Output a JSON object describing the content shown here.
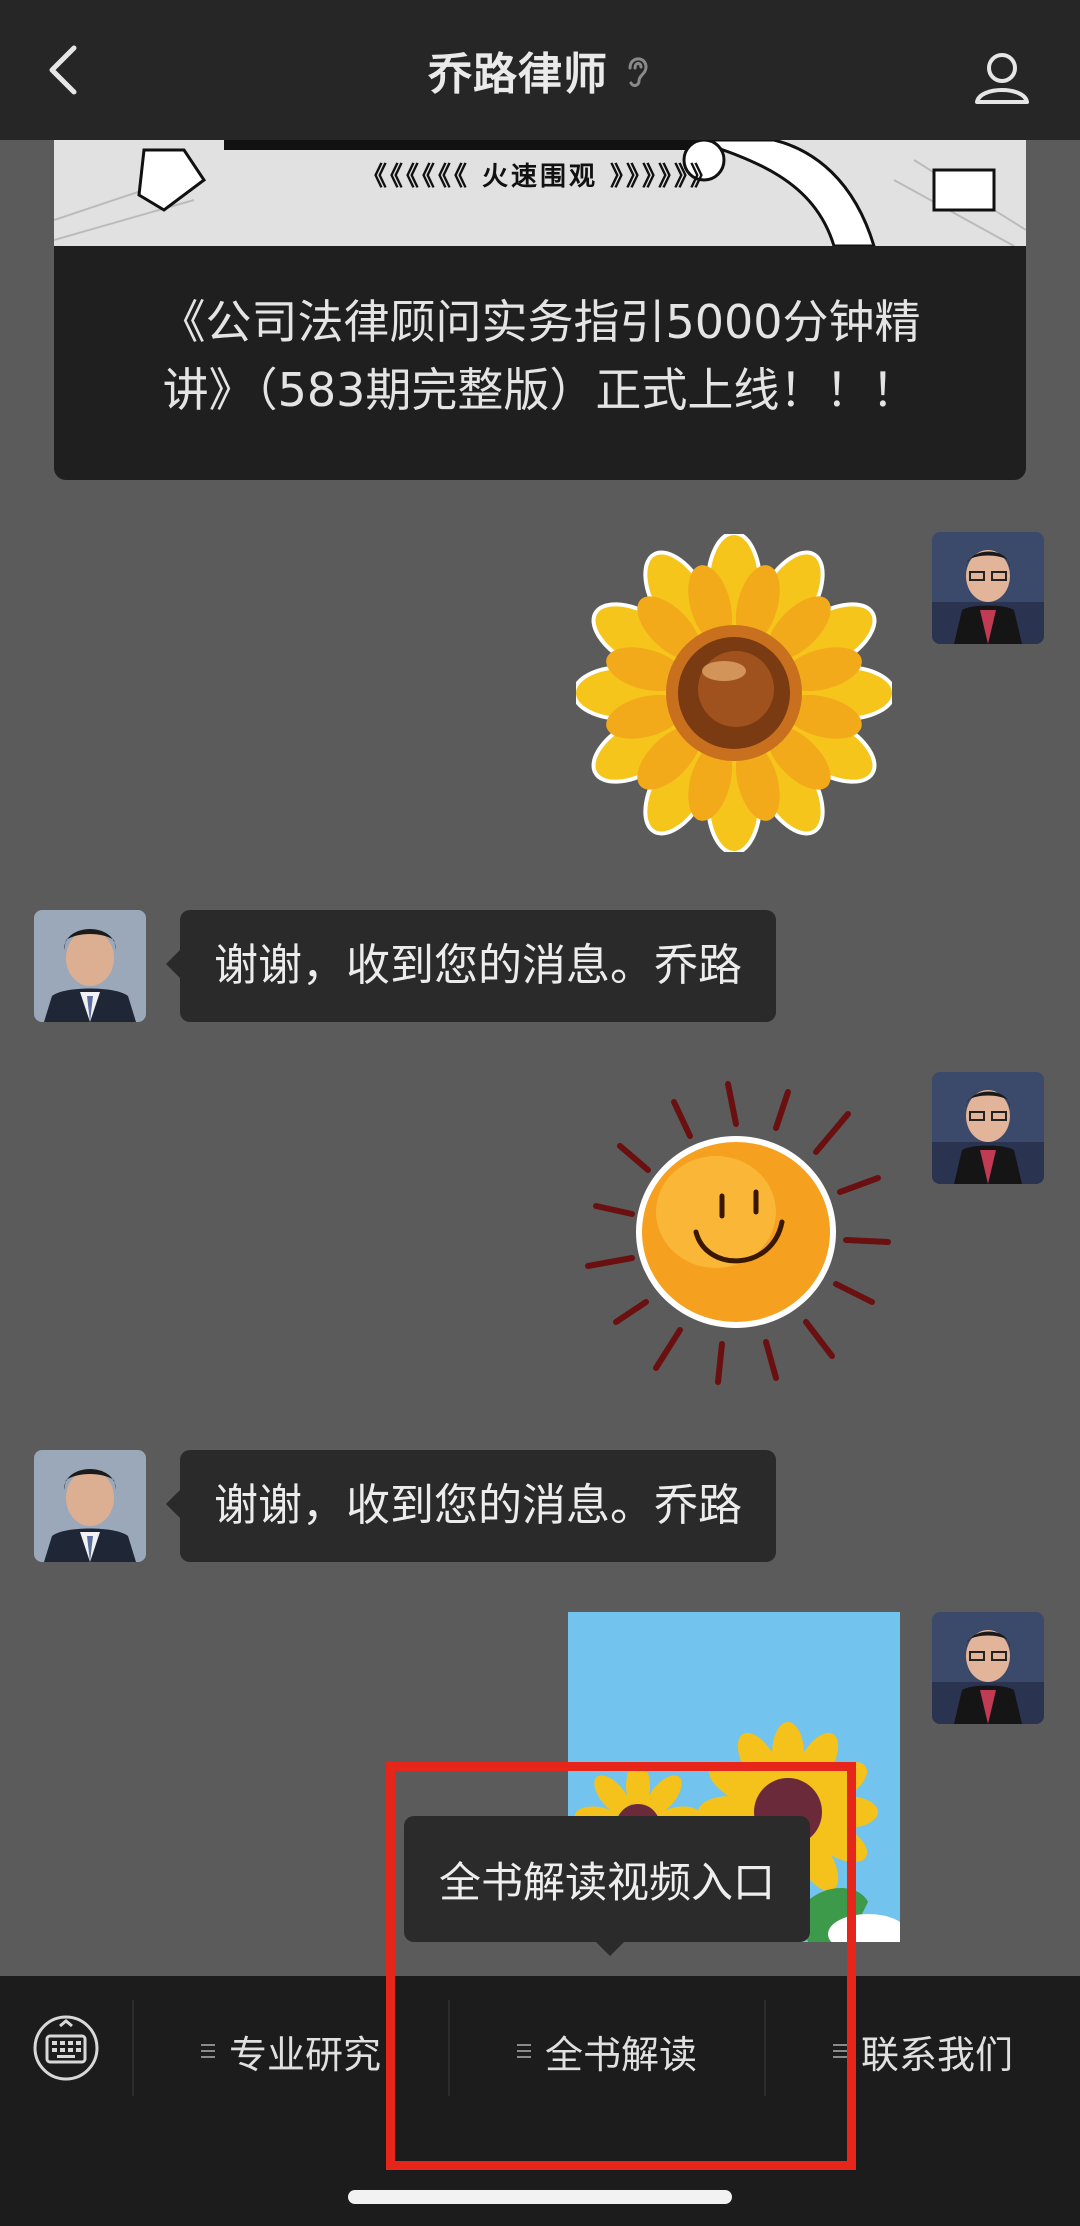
{
  "header": {
    "title": "乔路律师",
    "back_icon": "chevron-left-icon",
    "ear_icon": "ear-icon",
    "profile_icon": "person-icon"
  },
  "article": {
    "banner_text": "《《《《《《 火速围观 》》》》》》",
    "title_line1": "《公司法律顾问实务指引5000分钟精",
    "title_line2": "讲》（583期完整版）正式上线！！！"
  },
  "messages": [
    {
      "side": "right",
      "type": "sticker",
      "name": "sunflower"
    },
    {
      "side": "left",
      "type": "text",
      "text": "谢谢，收到您的消息。乔路"
    },
    {
      "side": "right",
      "type": "sticker",
      "name": "smiling-sun"
    },
    {
      "side": "left",
      "type": "text",
      "text": "谢谢，收到您的消息。乔路"
    },
    {
      "side": "right",
      "type": "image",
      "name": "sunflowers-photo"
    }
  ],
  "tooltip": {
    "text": "全书解读视频入口"
  },
  "menu": {
    "keyboard_icon": "keyboard-icon",
    "items": [
      {
        "label": "专业研究"
      },
      {
        "label": "全书解读"
      },
      {
        "label": "联系我们"
      }
    ]
  },
  "colors": {
    "chat_background": "#5b5b5b",
    "header_bg": "#262626",
    "bubble_bg": "#2a2a2a",
    "highlight": "#e6261a"
  }
}
